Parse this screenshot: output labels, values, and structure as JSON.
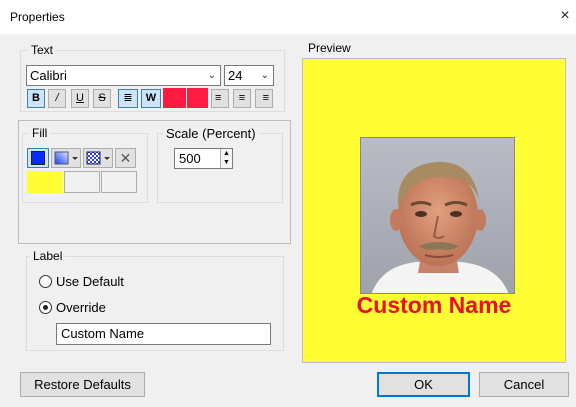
{
  "window": {
    "title": "Properties",
    "close_glyph": "×"
  },
  "text_group": {
    "legend": "Text",
    "font_family": "Calibri",
    "font_size": "24",
    "buttons": {
      "bold": "B",
      "italic": "/",
      "underline": "U",
      "strike": "S",
      "wrap": "≣",
      "whitespace": "W",
      "align_left": "≡",
      "align_center": "≡",
      "align_right": "≡"
    },
    "text_color": "#ff1a40"
  },
  "fill_group": {
    "legend": "Fill",
    "fill_color": "#0a2bff",
    "delete_glyph": "✕",
    "swatch_color": "#ffff33"
  },
  "scale_group": {
    "legend": "Scale (Percent)",
    "value": "500"
  },
  "label_group": {
    "legend": "Label",
    "option_default": "Use Default",
    "option_override": "Override",
    "override_selected": true,
    "override_value": "Custom Name"
  },
  "preview": {
    "heading": "Preview",
    "background": "#ffff33",
    "caption": "Custom Name",
    "caption_color": "#e8102e"
  },
  "footer": {
    "restore_label": "Restore Defaults",
    "ok_label": "OK",
    "cancel_label": "Cancel"
  }
}
